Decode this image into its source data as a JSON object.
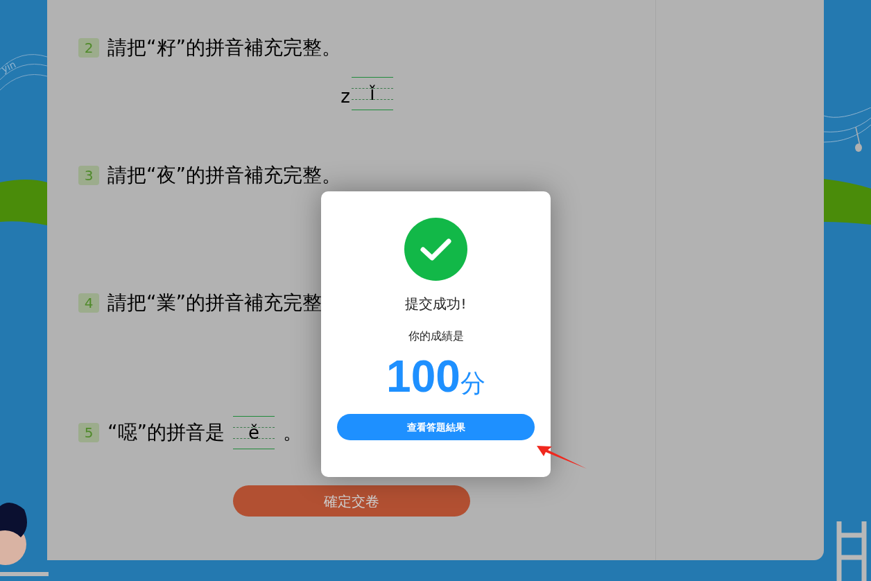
{
  "background": {
    "text": "yin"
  },
  "questions": [
    {
      "number": "2",
      "kind": "block",
      "prompt": "請把“籽”的拼音補充完整。",
      "prefix": "z",
      "answer": "ǐ"
    },
    {
      "number": "3",
      "kind": "plain",
      "prompt": "請把“夜”的拼音補充完整。"
    },
    {
      "number": "4",
      "kind": "plain",
      "prompt": "請把“業”的拼音補充完整"
    },
    {
      "number": "5",
      "kind": "inline",
      "prompt": "“噁”的拼音是",
      "answer": "ě",
      "suffix": "。"
    }
  ],
  "submit_button": "確定交卷",
  "dialog": {
    "title": "提交成功!",
    "subtitle": "你的成績是",
    "score": "100",
    "unit": "分",
    "button": "查看答題結果"
  }
}
